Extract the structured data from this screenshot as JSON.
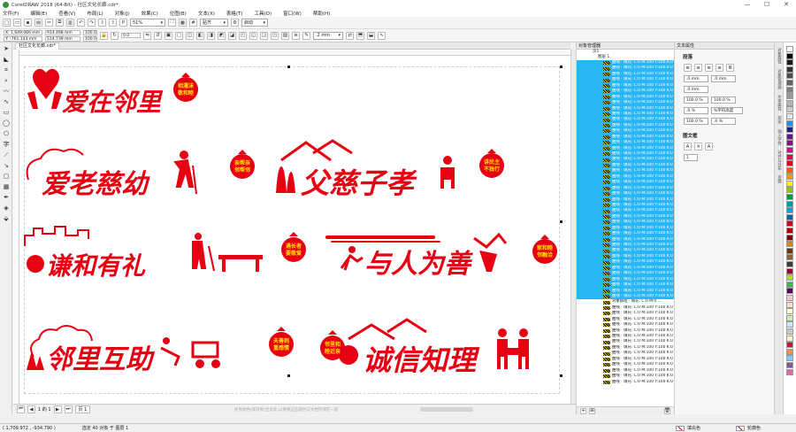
{
  "window": {
    "title": "CorelDRAW 2018 (64-Bit) - 社区文化长廊.cdr*",
    "min": "—",
    "max": "☐",
    "close": "✕"
  },
  "menu": [
    "文件(F)",
    "编辑(E)",
    "查看(V)",
    "布局(L)",
    "对象(J)",
    "效果(C)",
    "位图(B)",
    "文本(X)",
    "表格(T)",
    "工具(O)",
    "窗口(W)",
    "帮助(H)"
  ],
  "toolbar": {
    "zoom": "51%",
    "snap_label": "贴齐",
    "launch_label": "启动"
  },
  "propertybar": {
    "x": "X: 1,649.066 mm",
    "y": "Y: -761.133 mm",
    "w": "914.498 mm",
    "h": "514.739 mm",
    "scale_w": "100.0",
    "scale_h": "100.0",
    "angle": "0.0",
    "outline": ".2 mm"
  },
  "document_tab": "社区文化长廊.cdr*",
  "canvas": {
    "hint": "拖曳颜色(或对象)至此处,以便将这些颜色与文档存储在一起",
    "page_tab": "页 1",
    "page_nav": "1 的 1",
    "phrases": {
      "p1": "爱在邻里",
      "b1": "相濡沫\n敬和睦",
      "p2": "爱老慈幼",
      "b2": "亲帮亲\n邻帮邻",
      "p3": "父慈子孝",
      "b3": "讲民主\n不独行",
      "p4": "谦和有礼",
      "b4": "遇长者\n要敬爱",
      "p5": "与人为善",
      "b5": "家和睦\n邻融洽",
      "p6": "邻里互助",
      "b6": "夫善则\n重感情",
      "b7": "邻里和\n睦近亲",
      "p7": "诚信知理"
    }
  },
  "object_manager": {
    "title": "对象管理器",
    "page": "页1",
    "layer": "图层 1",
    "row_text": "曲线 · 填充: C:0 M:100 Y:100 K:0",
    "group_label": "对象群组 · 填充: C:0 M:0 ...",
    "selected_rows": 42,
    "unselected_rows": 14
  },
  "text_props": {
    "title": "文本属性",
    "paragraph": "段落",
    "frame": "图文框",
    "indent_left": ".0 mm",
    "indent_right": ".0 mm",
    "first": ".0 mm",
    "line_spacing": "100.0 %",
    "char_spacing": ".0 %",
    "line_unit": "%字符高度",
    "word_spacing": "100.0 %",
    "lang_spacing": "100.0 %",
    "before": ".0 %",
    "columns": "1"
  },
  "docker_tabs": [
    "对象属性",
    "对象管理器",
    "文本属性",
    "提示",
    "插入字符",
    "对齐与分布",
    "变换"
  ],
  "palette_colors": [
    "#ffffff",
    "#000000",
    "#1a1a1a",
    "#333333",
    "#4d4d4d",
    "#666666",
    "#808080",
    "#999999",
    "#b3b3b3",
    "#cccccc",
    "#e6e6e6",
    "#00a0e9",
    "#1d2088",
    "#601986",
    "#920783",
    "#e4007f",
    "#e5004f",
    "#e60012",
    "#eb6100",
    "#f39800",
    "#fff100",
    "#8fc31f",
    "#009944",
    "#009e96",
    "#00a0e9",
    "#0068b7",
    "#c30d23",
    "#a40000",
    "#7d0000",
    "#d28e00",
    "#6a3906",
    "#8c6239",
    "#3e3a39",
    "#9e0039",
    "#b4dc0f",
    "#43b649",
    "#5a0064",
    "#f7c5d2",
    "#fadcc8",
    "#ffffcc",
    "#d0e8bf",
    "#c7e6f7",
    "#c9caca",
    "#fff2cc",
    "#e60033",
    "#f19149",
    "#7ecef4",
    "#8957a1",
    "#ea68a2"
  ],
  "status": {
    "coords": "( 1,709.972 , -934.790 )",
    "selection": "选定 40 对象 于 图层 1",
    "fill": "填充色",
    "outline": "轮廓色"
  },
  "colors": {
    "accent_red": "#e60012",
    "selection_blue": "#29b6f6"
  }
}
